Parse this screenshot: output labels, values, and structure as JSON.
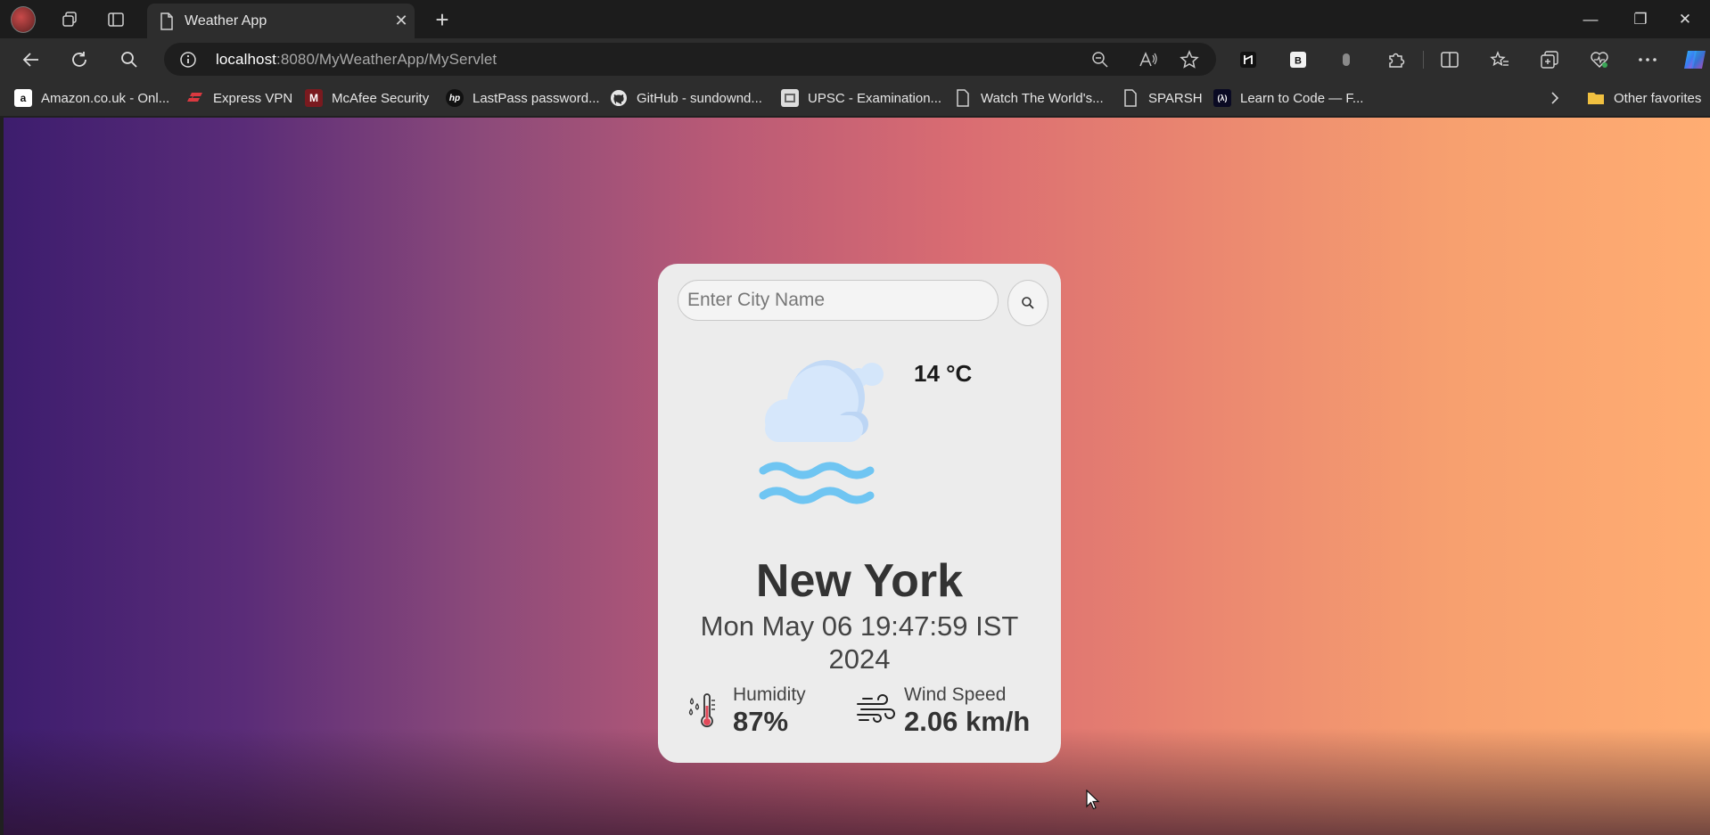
{
  "browser": {
    "tab": {
      "title": "Weather App",
      "close": "✕"
    },
    "new_tab": "+",
    "window_controls": {
      "minimize": "—",
      "restore": "❐",
      "close": "✕"
    },
    "address": {
      "host": "localhost",
      "rest": ":8080/MyWeatherApp/MyServlet"
    },
    "bookmarks": [
      {
        "label": "Amazon.co.uk - Onl...",
        "icon": "amazon-icon",
        "glyph": "a"
      },
      {
        "label": "Express VPN",
        "icon": "expressvpn-icon",
        "glyph": ""
      },
      {
        "label": "McAfee Security",
        "icon": "mcafee-icon",
        "glyph": "M"
      },
      {
        "label": "LastPass password...",
        "icon": "hp-icon",
        "glyph": "hp"
      },
      {
        "label": "GitHub - sundownd...",
        "icon": "github-icon",
        "glyph": ""
      },
      {
        "label": "UPSC - Examination...",
        "icon": "upsc-icon",
        "glyph": ""
      },
      {
        "label": "Watch The World's...",
        "icon": "page-icon",
        "glyph": ""
      },
      {
        "label": "SPARSH",
        "icon": "page-icon",
        "glyph": ""
      },
      {
        "label": "Learn to Code — F...",
        "icon": "freecodecamp-icon",
        "glyph": "(λ)"
      }
    ],
    "other_favorites": "Other favorites"
  },
  "weather": {
    "search_placeholder": "Enter City Name",
    "temperature": "14 °C",
    "city": "New York",
    "datetime": "Mon May 06 19:47:59 IST 2024",
    "humidity_label": "Humidity",
    "humidity_value": "87%",
    "wind_label": "Wind Speed",
    "wind_value": "2.06 km/h",
    "condition_icon": "cloud-mist-icon"
  },
  "colors": {
    "gradient_start": "#3d1d6e",
    "gradient_end": "#ffad72",
    "card_bg": "#ececec",
    "mist_blue": "#6fc5f2",
    "cloud_blue": "#d4e6fa"
  }
}
